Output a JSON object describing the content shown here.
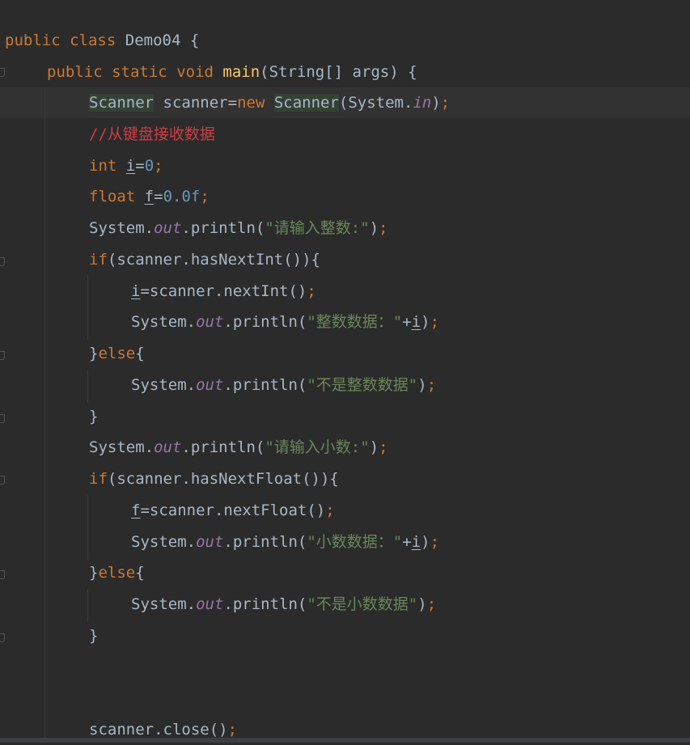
{
  "code": {
    "l1": {
      "kw1": "public",
      "kw2": "class",
      "name": "Demo04",
      "brace": "{"
    },
    "l2": {
      "kw1": "public",
      "kw2": "static",
      "kw3": "void",
      "fn": "main",
      "params": "(String[] args)",
      "brace": "{"
    },
    "l3": {
      "type": "Scanner",
      "var": "scanner",
      "eq": "=",
      "kw": "new",
      "ctor": "Scanner",
      "arg_open": "(System.",
      "arg_static": "in",
      "arg_close": ")",
      "semi": ";"
    },
    "l4": {
      "comment": "//从键盘接收数据"
    },
    "l5": {
      "kw": "int",
      "var": "i",
      "eq": "=",
      "val": "0",
      "semi": ";"
    },
    "l6": {
      "kw": "float",
      "var": "f",
      "eq": "=",
      "val": "0.0f",
      "semi": ";"
    },
    "l7": {
      "obj": "System.",
      "out": "out",
      "call": ".println(",
      "str": "\"请输入整数:\"",
      "close": ")",
      "semi": ";"
    },
    "l8": {
      "kw": "if",
      "cond": "(scanner.hasNextInt()){"
    },
    "l9": {
      "var": "i",
      "rest": "=scanner.nextInt()",
      "semi": ";"
    },
    "l10": {
      "obj": "System.",
      "out": "out",
      "call": ".println(",
      "str": "\"整数数据：\"",
      "plus": "+",
      "var": "i",
      "close": ")",
      "semi": ";"
    },
    "l11": {
      "brace": "}",
      "kw": "else",
      "brace2": "{"
    },
    "l12": {
      "obj": "System.",
      "out": "out",
      "call": ".println(",
      "str": "\"不是整数数据\"",
      "close": ")",
      "semi": ";"
    },
    "l13": {
      "brace": "}"
    },
    "l14": {
      "obj": "System.",
      "out": "out",
      "call": ".println(",
      "str": "\"请输入小数:\"",
      "close": ")",
      "semi": ";"
    },
    "l15": {
      "kw": "if",
      "cond": "(scanner.hasNextFloat()){"
    },
    "l16": {
      "var": "f",
      "rest": "=scanner.nextFloat()",
      "semi": ";"
    },
    "l17": {
      "obj": "System.",
      "out": "out",
      "call": ".println(",
      "str": "\"小数数据：\"",
      "plus": "+",
      "var": "i",
      "close": ")",
      "semi": ";"
    },
    "l18": {
      "brace": "}",
      "kw": "else",
      "brace2": "{"
    },
    "l19": {
      "obj": "System.",
      "out": "out",
      "call": ".println(",
      "str": "\"不是小数数据\"",
      "close": ")",
      "semi": ";"
    },
    "l20": {
      "brace": "}"
    },
    "l21": {
      "text": "scanner.close()",
      "semi": ";"
    }
  },
  "colors": {
    "background": "#2b2b2b",
    "keyword": "#cc7832",
    "string": "#6a8759",
    "number": "#6897bb",
    "static_field": "#9876aa",
    "comment": "#cc3e44",
    "method_decl": "#ffc66d",
    "default_text": "#a9b7c6"
  }
}
